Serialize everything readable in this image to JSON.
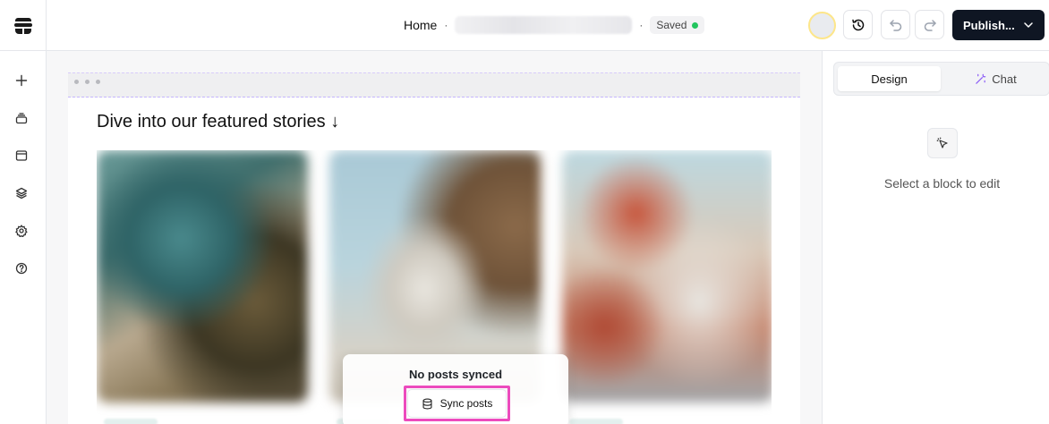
{
  "header": {
    "breadcrumb_home": "Home",
    "breadcrumb_separator": "·",
    "saved_label": "Saved",
    "publish_label": "Publish..."
  },
  "editor": {
    "heading": "Dive into our featured stories ↓",
    "empty_state_title": "No posts synced",
    "sync_button_label": "Sync posts"
  },
  "right_panel": {
    "tab_design": "Design",
    "tab_chat": "Chat",
    "empty_message": "Select a block to edit"
  },
  "colors": {
    "publish_bg": "#0f1623",
    "saved_dot": "#22c55e",
    "highlight": "#ec4bbd",
    "chat_icon": "#8b5cf6"
  }
}
